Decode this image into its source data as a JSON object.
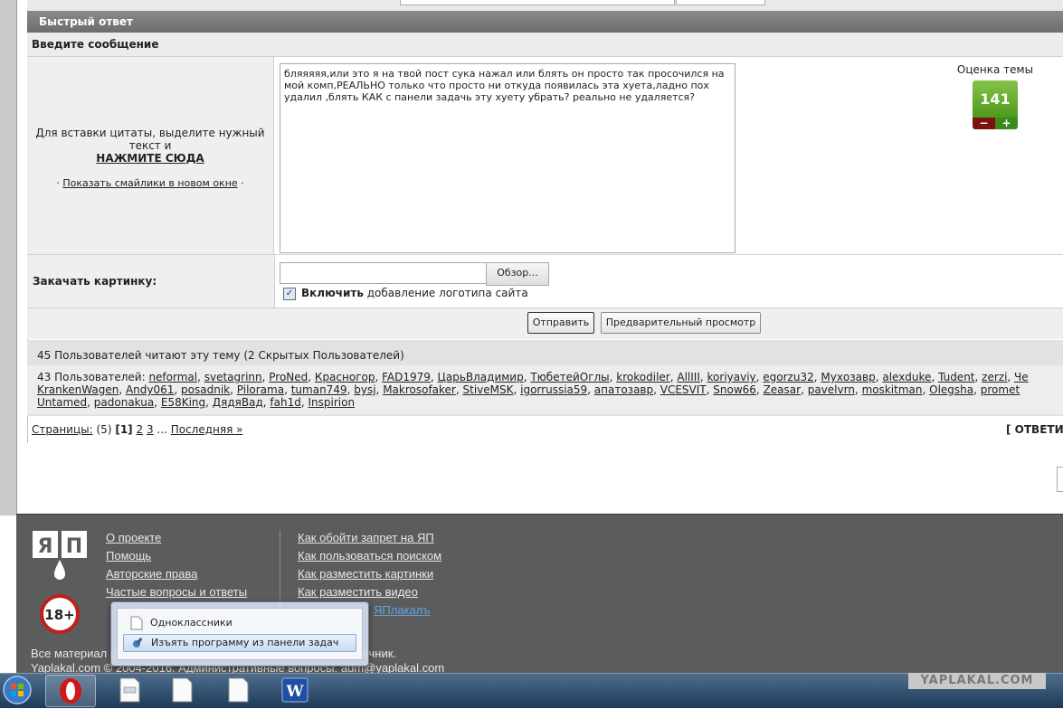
{
  "quick_reply": {
    "header": "Быстрый ответ",
    "enter_message": "Введите сообщение",
    "quote_hint": "Для вставки цитаты, выделите нужный текст и",
    "quote_click": "НАЖМИТЕ СЮДА",
    "smiles_prefix": "·",
    "smiles_link": "Показать смайлики в новом окне",
    "smiles_suffix": "·",
    "message_text": "бляяяяя,или это я на твой пост сука нажал или блять он просто так просочился на мой комп,РЕАЛЬНО только что просто ни откуда появилась эта хуета,ладно пох удалил ,блять КАК с панели задачь эту хуету убрать? реально не удаляется?",
    "rating_label": "Оценка темы",
    "rating_value": "141",
    "rating_minus": "−",
    "rating_plus": "+",
    "upload_label": "Закачать картинку:",
    "browse_button": "Обзор...",
    "checkbox_checked": true,
    "checkbox_mark": "✓",
    "checkbox_bold": "Включить",
    "checkbox_text": " добавление логотипа сайта",
    "send_button": "Отправить",
    "preview_button": "Предварительный просмотр"
  },
  "readers": {
    "title": "45 Пользователей читают эту тему (2 Скрытых Пользователей)",
    "prefix": "43 Пользователей:",
    "users": [
      "neformal",
      "svetagrinn",
      "ProNed",
      "Красногор",
      "FAD1979",
      "ЦарьВладимир",
      "ТюбетейОглы",
      "krokodiler",
      "AllIII",
      "koriyaviy",
      "egorzu32",
      "Мухозавр",
      "alexduke",
      "Tudent",
      "zerzi",
      "Че",
      "KrankenWagen",
      "Andy061",
      "posadnik",
      "Pilorama",
      "tuman749",
      "bysj",
      "Makrosofaker",
      "StiveMSK",
      "igorrussia59",
      "апатозавр",
      "VCESVIT",
      "Snow66",
      "Zeasar",
      "pavelvrn",
      "moskitman",
      "Olegsha",
      "promet",
      "Untamed",
      "padonakua",
      "E58King",
      "ДядяВад",
      "fah1d",
      "Inspirion"
    ]
  },
  "pagination": {
    "label": "Страницы:",
    "count": "(5)",
    "current": "[1]",
    "p2": "2",
    "p3": "3",
    "dots": "...",
    "last": "Последняя »",
    "reply": "[ ОТВЕТИ"
  },
  "footer": {
    "links_left": [
      "О проекте",
      "Помощь",
      "Авторские права",
      "Частые вопросы и ответы"
    ],
    "links_right": [
      "Как обойти запрет на ЯП",
      "Как пользоваться поиском",
      "Как разместить картинки",
      "Как разместить видео",
      "ЯПлакалъ"
    ],
    "note1": "Все материал                                                    ровании необходимо указывать ссылку на источник.",
    "note2": "Yaplakal.com © 2004-2016. Административные вопросы: adm@yaplakal.com",
    "age_badge": "18+",
    "logo_text": "ЯП"
  },
  "context_menu": {
    "items": [
      "Одноклассники",
      "Изъять программу из панели задач"
    ]
  },
  "taskbar": {
    "watermark": "YAPLAKAL.COM"
  }
}
